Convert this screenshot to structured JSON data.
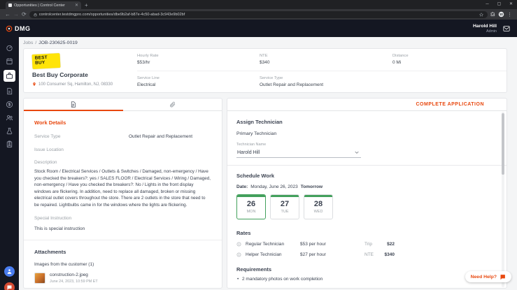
{
  "browser": {
    "tab": {
      "title": "Opportunities | Control Center"
    },
    "url": "controlcenter.testdmgpro.com/opportunities/dbe9b2af-b87e-4c50-abad-3c943e9b02bf",
    "window_controls": {
      "minimize": "─",
      "maximize": "▢",
      "close": "✕"
    },
    "icons": {
      "back": "←",
      "forward": "→",
      "refresh": "⟳",
      "menu": "⋮",
      "new_tab": "+",
      "close_tab": "✕"
    }
  },
  "app_header": {
    "logo_text": "DMG",
    "user": {
      "name": "Harold Hill",
      "role": "Admin"
    }
  },
  "breadcrumb": {
    "section": "Jobs",
    "separator": "/",
    "job_id": "JOB-230625-0019"
  },
  "job_summary": {
    "logo_line1": "BEST",
    "logo_line2": "BUY",
    "company_name": "Best Buy Corporate",
    "address": "100 Consumer Sq, Hamilton, NJ, 08330",
    "fields": {
      "hourly_rate": {
        "label": "Hourly Rate",
        "value": "$53/hr"
      },
      "nte": {
        "label": "NTE",
        "value": "$340"
      },
      "distance": {
        "label": "Distance",
        "value": "0 Mi"
      },
      "service_line": {
        "label": "Service Line",
        "value": "Electrical"
      },
      "service_type": {
        "label": "Service Type",
        "value": "Outlet Repair and Replacement"
      }
    }
  },
  "work_details": {
    "title": "Work Details",
    "service_type": {
      "label": "Service Type",
      "value": "Outlet Repair and Replacement"
    },
    "issue_location": {
      "label": "Issue Location",
      "value": ""
    },
    "description": {
      "label": "Description",
      "value": "Stock Room / Electrical Services / Outlets & Switches / Damaged, non-emergency / Have you checked the breakers?: yes / SALES FLOOR / Electrical Services / Wiring / Damaged, non-emergency / Have you checked the breakers?: No / Lights in the front display windows are flickering. In addition, need to replace all damaged, broken or missing electrical outlet covers throughout the store. There are 2 outlets in the store that need to be repaired. Lightbulbs came in for the windows where the lights are flickering."
    },
    "special_instruction": {
      "label": "Special Instruction",
      "value": "This is special instruction"
    },
    "attachments": {
      "title": "Attachments",
      "group_label": "Images from the customer (1)",
      "files": [
        {
          "name": "construction-2.jpeg",
          "date": "June 24, 2023, 10:59 PM ET"
        }
      ]
    }
  },
  "application_panel": {
    "complete_button": "COMPLETE APPLICATION",
    "assign_technician": {
      "title": "Assign Technician",
      "subtitle": "Primary Technician",
      "field_label": "Technician Name",
      "selected_technician": "Harold Hill"
    },
    "schedule": {
      "title": "Schedule Work",
      "date_label": "Date:",
      "date_value": "Monday, June 26, 2023",
      "date_badge": "Tomorrow",
      "dates": [
        {
          "day": "26",
          "weekday": "MON"
        },
        {
          "day": "27",
          "weekday": "TUE"
        },
        {
          "day": "28",
          "weekday": "WED"
        }
      ]
    },
    "rates": {
      "title": "Rates",
      "rows": [
        {
          "name": "Regular Technician",
          "rate": "$53 per hour",
          "extra_label": "Trip",
          "extra_value": "$22"
        },
        {
          "name": "Helper Technician",
          "rate": "$27 per hour",
          "extra_label": "NTE",
          "extra_value": "$340"
        }
      ]
    },
    "requirements": {
      "title": "Requirements",
      "items": [
        "2 mandatory photos on work completion"
      ]
    }
  },
  "help_button": {
    "label": "Need Help?"
  }
}
